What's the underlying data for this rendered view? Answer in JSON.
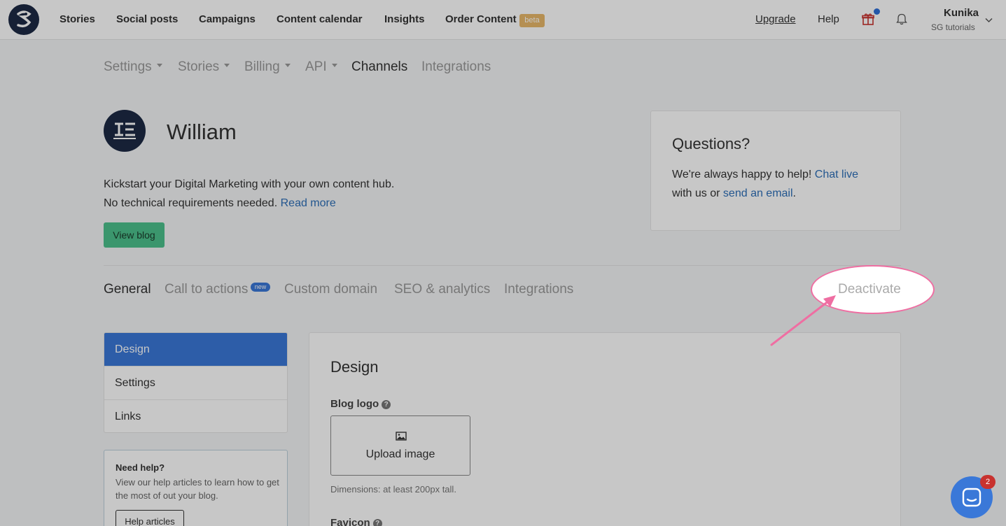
{
  "topnav": {
    "items": [
      "Stories",
      "Social posts",
      "Campaigns",
      "Content calendar",
      "Insights",
      "Order Content"
    ],
    "beta_label": "beta",
    "upgrade": "Upgrade",
    "help": "Help",
    "user_name": "Kunika",
    "user_org": "SG tutorials",
    "notification_color": "#2d6fd8"
  },
  "subnav": {
    "items": [
      "Settings",
      "Stories",
      "Billing",
      "API",
      "Channels",
      "Integrations"
    ],
    "active": "Channels"
  },
  "blog": {
    "title": "William",
    "desc_line1": "Kickstart your Digital Marketing with your own content hub.",
    "desc_line2": "No technical requirements needed.",
    "read_more": "Read more",
    "view_blog": "View blog"
  },
  "questions": {
    "title": "Questions?",
    "line1_prefix": "We're always happy to help!",
    "chat_live": "Chat live",
    "line2_prefix": "with us or",
    "send_email": "send an email",
    "line2_suffix": "."
  },
  "tabs": {
    "items": [
      "General",
      "Call to actions",
      "Custom domain",
      "SEO & analytics",
      "Integrations"
    ],
    "new_badge": "new",
    "active": "General",
    "deactivate": "Deactivate"
  },
  "sidemenu": {
    "items": [
      "Design",
      "Settings",
      "Links"
    ],
    "active": "Design"
  },
  "helpbox": {
    "title": "Need help?",
    "text": "View our help articles to learn how to get the most of out your blog.",
    "button": "Help articles"
  },
  "design": {
    "title": "Design",
    "blog_logo_label": "Blog logo",
    "upload": "Upload image",
    "dims": "Dimensions: at least 200px tall.",
    "favicon_label": "Favicon"
  },
  "chat": {
    "count": "2",
    "accent": "#3a78d8"
  },
  "colors": {
    "accent": "#3a78d8",
    "primary_green": "#4cc18c",
    "annotation_pink": "#ef6ea2"
  }
}
